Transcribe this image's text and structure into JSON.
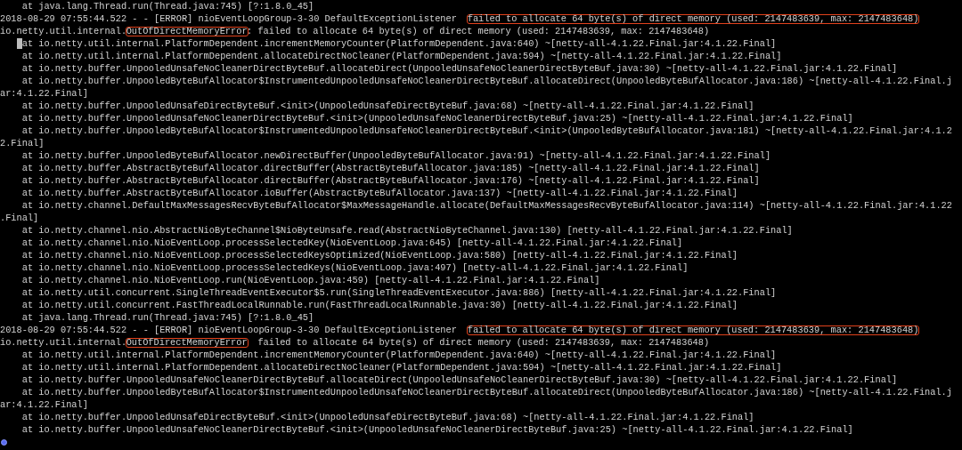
{
  "terminal": {
    "lines": [
      {
        "kind": "frame",
        "segments": [
          {
            "text": "at java.lang.Thread.run(Thread.java:745) [?:1.8.0_45]",
            "highlighted": false
          }
        ]
      },
      {
        "kind": "log",
        "segments": [
          {
            "text": "2018-08-29 07:55:44.522 - - [ERROR] nioEventLoopGroup-3-30 DefaultExceptionListener  ",
            "highlighted": false
          },
          {
            "text": "failed to allocate 64 byte(s) of direct memory (used: 2147483639, max: 2147483648)",
            "highlighted": true
          }
        ]
      },
      {
        "kind": "log",
        "segments": [
          {
            "text": "io.netty.util.internal.",
            "highlighted": false
          },
          {
            "text": "OutOfDirectMemoryError",
            "highlighted": true
          },
          {
            "text": ": failed to allocate 64 byte(s) of direct memory (used: 2147483639, max: 2147483648)",
            "highlighted": false
          }
        ]
      },
      {
        "kind": "frame",
        "cursor": true,
        "segments": [
          {
            "text": "at io.netty.util.internal.PlatformDependent.incrementMemoryCounter(PlatformDependent.java:640) ~[netty-all-4.1.22.Final.jar:4.1.22.Final]",
            "highlighted": false
          }
        ]
      },
      {
        "kind": "frame",
        "segments": [
          {
            "text": "at io.netty.util.internal.PlatformDependent.allocateDirectNoCleaner(PlatformDependent.java:594) ~[netty-all-4.1.22.Final.jar:4.1.22.Final]",
            "highlighted": false
          }
        ]
      },
      {
        "kind": "frame",
        "segments": [
          {
            "text": "at io.netty.buffer.UnpooledUnsafeNoCleanerDirectByteBuf.allocateDirect(UnpooledUnsafeNoCleanerDirectByteBuf.java:30) ~[netty-all-4.1.22.Final.jar:4.1.22.Final]",
            "highlighted": false
          }
        ]
      },
      {
        "kind": "frame",
        "segments": [
          {
            "text": "at io.netty.buffer.UnpooledByteBufAllocator$InstrumentedUnpooledUnsafeNoCleanerDirectByteBuf.allocateDirect(UnpooledByteBufAllocator.java:186) ~[netty-all-4.1.22.Final.j",
            "highlighted": false
          }
        ]
      },
      {
        "kind": "wrap",
        "segments": [
          {
            "text": "ar:4.1.22.Final]",
            "highlighted": false
          }
        ]
      },
      {
        "kind": "frame",
        "segments": [
          {
            "text": "at io.netty.buffer.UnpooledUnsafeDirectByteBuf.<init>(UnpooledUnsafeDirectByteBuf.java:68) ~[netty-all-4.1.22.Final.jar:4.1.22.Final]",
            "highlighted": false
          }
        ]
      },
      {
        "kind": "frame",
        "segments": [
          {
            "text": "at io.netty.buffer.UnpooledUnsafeNoCleanerDirectByteBuf.<init>(UnpooledUnsafeNoCleanerDirectByteBuf.java:25) ~[netty-all-4.1.22.Final.jar:4.1.22.Final]",
            "highlighted": false
          }
        ]
      },
      {
        "kind": "frame",
        "segments": [
          {
            "text": "at io.netty.buffer.UnpooledByteBufAllocator$InstrumentedUnpooledUnsafeNoCleanerDirectByteBuf.<init>(UnpooledByteBufAllocator.java:181) ~[netty-all-4.1.22.Final.jar:4.1.2",
            "highlighted": false
          }
        ]
      },
      {
        "kind": "wrap",
        "segments": [
          {
            "text": "2.Final]",
            "highlighted": false
          }
        ]
      },
      {
        "kind": "frame",
        "segments": [
          {
            "text": "at io.netty.buffer.UnpooledByteBufAllocator.newDirectBuffer(UnpooledByteBufAllocator.java:91) ~[netty-all-4.1.22.Final.jar:4.1.22.Final]",
            "highlighted": false
          }
        ]
      },
      {
        "kind": "frame",
        "segments": [
          {
            "text": "at io.netty.buffer.AbstractByteBufAllocator.directBuffer(AbstractByteBufAllocator.java:185) ~[netty-all-4.1.22.Final.jar:4.1.22.Final]",
            "highlighted": false
          }
        ]
      },
      {
        "kind": "frame",
        "segments": [
          {
            "text": "at io.netty.buffer.AbstractByteBufAllocator.directBuffer(AbstractByteBufAllocator.java:176) ~[netty-all-4.1.22.Final.jar:4.1.22.Final]",
            "highlighted": false
          }
        ]
      },
      {
        "kind": "frame",
        "segments": [
          {
            "text": "at io.netty.buffer.AbstractByteBufAllocator.ioBuffer(AbstractByteBufAllocator.java:137) ~[netty-all-4.1.22.Final.jar:4.1.22.Final]",
            "highlighted": false
          }
        ]
      },
      {
        "kind": "frame",
        "segments": [
          {
            "text": "at io.netty.channel.DefaultMaxMessagesRecvByteBufAllocator$MaxMessageHandle.allocate(DefaultMaxMessagesRecvByteBufAllocator.java:114) ~[netty-all-4.1.22.Final.jar:4.1.22",
            "highlighted": false
          }
        ]
      },
      {
        "kind": "wrap",
        "segments": [
          {
            "text": ".Final]",
            "highlighted": false
          }
        ]
      },
      {
        "kind": "frame",
        "segments": [
          {
            "text": "at io.netty.channel.nio.AbstractNioByteChannel$NioByteUnsafe.read(AbstractNioByteChannel.java:130) [netty-all-4.1.22.Final.jar:4.1.22.Final]",
            "highlighted": false
          }
        ]
      },
      {
        "kind": "frame",
        "segments": [
          {
            "text": "at io.netty.channel.nio.NioEventLoop.processSelectedKey(NioEventLoop.java:645) [netty-all-4.1.22.Final.jar:4.1.22.Final]",
            "highlighted": false
          }
        ]
      },
      {
        "kind": "frame",
        "segments": [
          {
            "text": "at io.netty.channel.nio.NioEventLoop.processSelectedKeysOptimized(NioEventLoop.java:580) [netty-all-4.1.22.Final.jar:4.1.22.Final]",
            "highlighted": false
          }
        ]
      },
      {
        "kind": "frame",
        "segments": [
          {
            "text": "at io.netty.channel.nio.NioEventLoop.processSelectedKeys(NioEventLoop.java:497) [netty-all-4.1.22.Final.jar:4.1.22.Final]",
            "highlighted": false
          }
        ]
      },
      {
        "kind": "frame",
        "segments": [
          {
            "text": "at io.netty.channel.nio.NioEventLoop.run(NioEventLoop.java:459) [netty-all-4.1.22.Final.jar:4.1.22.Final]",
            "highlighted": false
          }
        ]
      },
      {
        "kind": "frame",
        "segments": [
          {
            "text": "at io.netty.util.concurrent.SingleThreadEventExecutor$5.run(SingleThreadEventExecutor.java:886) [netty-all-4.1.22.Final.jar:4.1.22.Final]",
            "highlighted": false
          }
        ]
      },
      {
        "kind": "frame",
        "segments": [
          {
            "text": "at io.netty.util.concurrent.FastThreadLocalRunnable.run(FastThreadLocalRunnable.java:30) [netty-all-4.1.22.Final.jar:4.1.22.Final]",
            "highlighted": false
          }
        ]
      },
      {
        "kind": "frame",
        "segments": [
          {
            "text": "at java.lang.Thread.run(Thread.java:745) [?:1.8.0_45]",
            "highlighted": false
          }
        ]
      },
      {
        "kind": "log",
        "segments": [
          {
            "text": "2018-08-29 07:55:44.522 - - [ERROR] nioEventLoopGroup-3-30 DefaultExceptionListener  ",
            "highlighted": false
          },
          {
            "text": "failed to allocate 64 byte(s) of direct memory (used: 2147483639, max: 2147483648)",
            "highlighted": true
          }
        ]
      },
      {
        "kind": "log",
        "segments": [
          {
            "text": "io.netty.util.internal.",
            "highlighted": false
          },
          {
            "text": "OutOfDirectMemoryError",
            "highlighted": true
          },
          {
            "text": "  failed to allocate 64 byte(s) of direct memory (used: 2147483639, max: 2147483648)",
            "highlighted": false
          }
        ]
      },
      {
        "kind": "frame",
        "segments": [
          {
            "text": "at io.netty.util.internal.PlatformDependent.incrementMemoryCounter(PlatformDependent.java:640) ~[netty-all-4.1.22.Final.jar:4.1.22.Final]",
            "highlighted": false
          }
        ]
      },
      {
        "kind": "frame",
        "segments": [
          {
            "text": "at io.netty.util.internal.PlatformDependent.allocateDirectNoCleaner(PlatformDependent.java:594) ~[netty-all-4.1.22.Final.jar:4.1.22.Final]",
            "highlighted": false
          }
        ]
      },
      {
        "kind": "frame",
        "segments": [
          {
            "text": "at io.netty.buffer.UnpooledUnsafeNoCleanerDirectByteBuf.allocateDirect(UnpooledUnsafeNoCleanerDirectByteBuf.java:30) ~[netty-all-4.1.22.Final.jar:4.1.22.Final]",
            "highlighted": false
          }
        ]
      },
      {
        "kind": "frame",
        "segments": [
          {
            "text": "at io.netty.buffer.UnpooledByteBufAllocator$InstrumentedUnpooledUnsafeNoCleanerDirectByteBuf.allocateDirect(UnpooledByteBufAllocator.java:186) ~[netty-all-4.1.22.Final.j",
            "highlighted": false
          }
        ]
      },
      {
        "kind": "wrap",
        "segments": [
          {
            "text": "ar:4.1.22.Final]",
            "highlighted": false
          }
        ]
      },
      {
        "kind": "frame",
        "segments": [
          {
            "text": "at io.netty.buffer.UnpooledUnsafeDirectByteBuf.<init>(UnpooledUnsafeDirectByteBuf.java:68) ~[netty-all-4.1.22.Final.jar:4.1.22.Final]",
            "highlighted": false
          }
        ]
      },
      {
        "kind": "frame",
        "segments": [
          {
            "text": "at io.netty.buffer.UnpooledUnsafeNoCleanerDirectByteBuf.<init>(UnpooledUnsafeNoCleanerDirectByteBuf.java:25) ~[netty-all-4.1.22.Final.jar:4.1.22.Final]",
            "highlighted": false
          }
        ]
      }
    ]
  }
}
